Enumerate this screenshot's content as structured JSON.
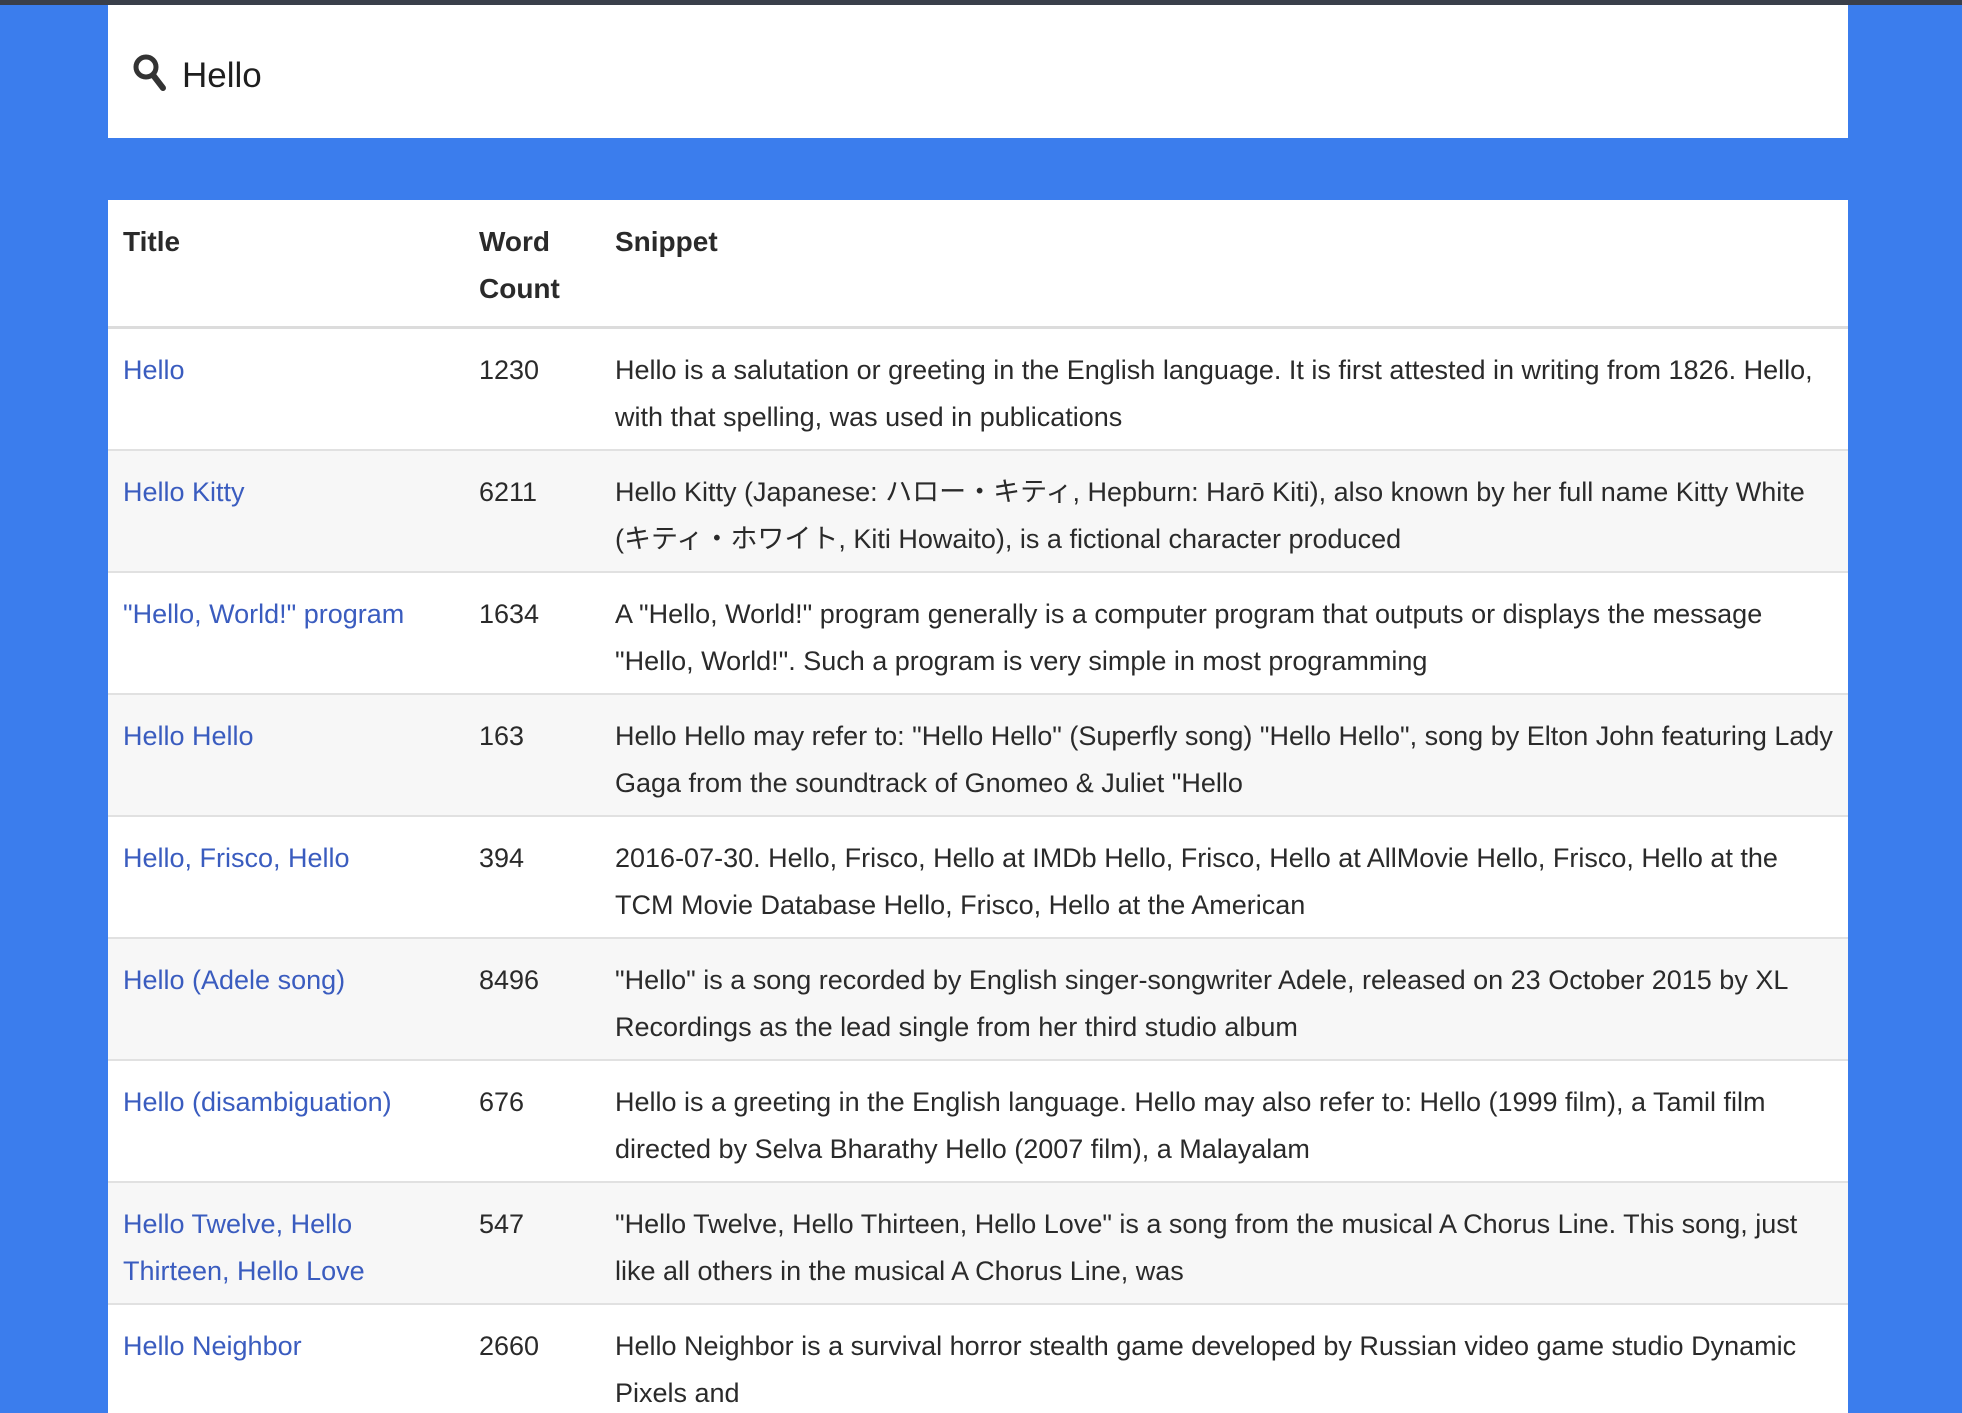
{
  "search": {
    "query": "Hello"
  },
  "colors": {
    "background": "#3b7ded",
    "link": "#3a5cbf",
    "panel": "#ffffff"
  },
  "table": {
    "headers": {
      "title": "Title",
      "word_count": "Word Count",
      "snippet": "Snippet"
    },
    "rows": [
      {
        "title": "Hello",
        "word_count": "1230",
        "snippet": "Hello is a salutation or greeting in the English language. It is first attested in writing from 1826. Hello, with that spelling, was used in publications"
      },
      {
        "title": "Hello Kitty",
        "word_count": "6211",
        "snippet": "Hello Kitty (Japanese: ハロー・キティ, Hepburn: Harō Kiti), also known by her full name Kitty White (キティ・ホワイト, Kiti Howaito), is a fictional character produced"
      },
      {
        "title": "\"Hello, World!\" program",
        "word_count": "1634",
        "snippet": "A \"Hello, World!\" program generally is a computer program that outputs or displays the message \"Hello, World!\". Such a program is very simple in most programming"
      },
      {
        "title": "Hello Hello",
        "word_count": "163",
        "snippet": "Hello Hello may refer to: \"Hello Hello\" (Superfly song) \"Hello Hello\", song by Elton John featuring Lady Gaga from the soundtrack of Gnomeo & Juliet \"Hello"
      },
      {
        "title": "Hello, Frisco, Hello",
        "word_count": "394",
        "snippet": "2016-07-30. Hello, Frisco, Hello at IMDb  Hello, Frisco, Hello at AllMovie Hello, Frisco, Hello at the TCM Movie Database Hello, Frisco, Hello at the American"
      },
      {
        "title": "Hello (Adele song)",
        "word_count": "8496",
        "snippet": "\"Hello\" is a song recorded by English singer-songwriter Adele, released on 23 October 2015 by XL Recordings as the lead single from her third studio album"
      },
      {
        "title": "Hello (disambiguation)",
        "word_count": "676",
        "snippet": "Hello is a greeting in the English language. Hello may also refer to: Hello (1999 film), a Tamil film directed by Selva Bharathy Hello (2007 film), a Malayalam"
      },
      {
        "title": "Hello Twelve, Hello Thirteen, Hello Love",
        "word_count": "547",
        "snippet": "\"Hello Twelve, Hello Thirteen, Hello Love\" is a song from the musical A Chorus Line. This song, just like all others in the musical A Chorus Line, was"
      },
      {
        "title": "Hello Neighbor",
        "word_count": "2660",
        "snippet": "Hello Neighbor is a survival horror stealth game developed by Russian video game studio Dynamic Pixels and"
      }
    ]
  }
}
